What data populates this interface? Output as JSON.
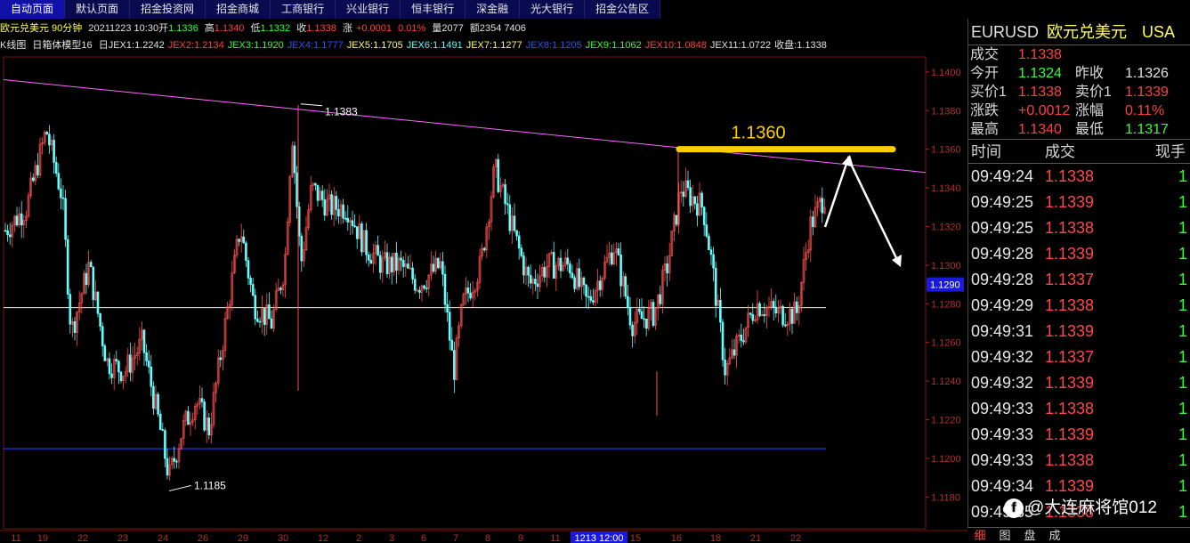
{
  "tabs": [
    {
      "label": "自动页面",
      "active": true
    },
    {
      "label": "默认页面"
    },
    {
      "label": "招金投资网"
    },
    {
      "label": "招金商城"
    },
    {
      "label": "工商银行"
    },
    {
      "label": "兴业银行"
    },
    {
      "label": "恒丰银行"
    },
    {
      "label": "深金融"
    },
    {
      "label": "光大银行"
    },
    {
      "label": "招金公告区"
    }
  ],
  "header": {
    "symbol_period": "欧元兑美元 90分钟",
    "datetime": "20211223 10:30",
    "open_label": "开",
    "open": "1.1336",
    "high_label": "高",
    "high": "1.1340",
    "low_label": "低",
    "low": "1.1332",
    "close_label": "收",
    "close": "1.1338",
    "change_label": "涨",
    "change": "+0.0001",
    "change_pct": "0.01%",
    "volume_label": "量",
    "volume": "2077",
    "amount_label": "额",
    "amount": "2354 7406"
  },
  "indicator_line": {
    "prefix": "K线图",
    "model": "日箱体模型16",
    "items": [
      {
        "text": "日JEX1:1.2242",
        "color": "#e0e0e0"
      },
      {
        "text": "JEX2:1.2134",
        "color": "#ff4040"
      },
      {
        "text": "JEX3:1.1920",
        "color": "#33ff33"
      },
      {
        "text": "JEX4:1.1777",
        "color": "#3050ff"
      },
      {
        "text": "JEX5:1.1705",
        "color": "#ffff55"
      },
      {
        "text": "JEX6:1.1491",
        "color": "#55ffff"
      },
      {
        "text": "JEX7:1.1277",
        "color": "#ffff55"
      },
      {
        "text": "JEX8:1.1205",
        "color": "#3050ff"
      },
      {
        "text": "JEX9:1.1062",
        "color": "#33ff33"
      },
      {
        "text": "JEX10:1.0848",
        "color": "#ff4040"
      },
      {
        "text": "JEX11:1.0722",
        "color": "#e0e0e0"
      },
      {
        "text": "收盘:1.1338",
        "color": "#e0e0e0"
      }
    ]
  },
  "chart_data": {
    "type": "candlestick",
    "y_ticks": [
      "1.1400",
      "1.1380",
      "1.1360",
      "1.1340",
      "1.1320",
      "1.1300",
      "1.1290",
      "1.1280",
      "1.1260",
      "1.1240",
      "1.1220",
      "1.1200",
      "1.1180"
    ],
    "ylim": [
      1.117,
      1.1405
    ],
    "current_price": "1.1290",
    "x_labels": [
      "11",
      "19",
      "22",
      "23",
      "24",
      "26",
      "29",
      "30",
      "12",
      "2",
      "3",
      "6",
      "7",
      "8",
      "9",
      "11",
      "1213 12:00",
      "15",
      "16",
      "18",
      "21",
      "22"
    ],
    "annotations": {
      "high": "1.1383",
      "low": "1.1185",
      "resistance": "1.1360"
    },
    "lines": {
      "resistance_level": 1.136,
      "horizontal_mid": 1.1278,
      "horizontal_low": 1.1205,
      "trendline_start": 1.1396,
      "trendline_end": 1.1348
    }
  },
  "quote": {
    "symbol": "EURUSD",
    "name": "欧元兑美元",
    "market": "USA",
    "last_label": "成交",
    "last": "1.1338",
    "open_label": "今开",
    "open": "1.1324",
    "prev_label": "昨收",
    "prev": "1.1326",
    "bid_label": "买价1",
    "bid": "1.1338",
    "ask_label": "卖价1",
    "ask": "1.1339",
    "chg_label": "涨跌",
    "chg": "+0.0012",
    "chgpct_label": "涨幅",
    "chgpct": "0.11%",
    "high_label": "最高",
    "high": "1.1340",
    "low_label": "最低",
    "low": "1.1317"
  },
  "ticks": {
    "col_time": "时间",
    "col_price": "成交",
    "col_qty": "现手",
    "rows": [
      {
        "time": "09:49:24",
        "price": "1.1338",
        "qty": "1"
      },
      {
        "time": "09:49:25",
        "price": "1.1339",
        "qty": "1"
      },
      {
        "time": "09:49:25",
        "price": "1.1338",
        "qty": "1"
      },
      {
        "time": "09:49:28",
        "price": "1.1339",
        "qty": "1"
      },
      {
        "time": "09:49:28",
        "price": "1.1337",
        "qty": "1"
      },
      {
        "time": "09:49:29",
        "price": "1.1338",
        "qty": "1"
      },
      {
        "time": "09:49:31",
        "price": "1.1339",
        "qty": "1"
      },
      {
        "time": "09:49:32",
        "price": "1.1337",
        "qty": "1"
      },
      {
        "time": "09:49:32",
        "price": "1.1339",
        "qty": "1"
      },
      {
        "time": "09:49:33",
        "price": "1.1338",
        "qty": "1"
      },
      {
        "time": "09:49:33",
        "price": "1.1339",
        "qty": "1"
      },
      {
        "time": "09:49:33",
        "price": "1.1338",
        "qty": "1"
      },
      {
        "time": "09:49:34",
        "price": "1.1339",
        "qty": "1"
      },
      {
        "time": "09:49:35",
        "price": "1.1338",
        "qty": "1"
      }
    ]
  },
  "watermark": "@大连麻将馆012",
  "bottom_tabs": [
    "细",
    "图",
    "盘",
    "成"
  ]
}
